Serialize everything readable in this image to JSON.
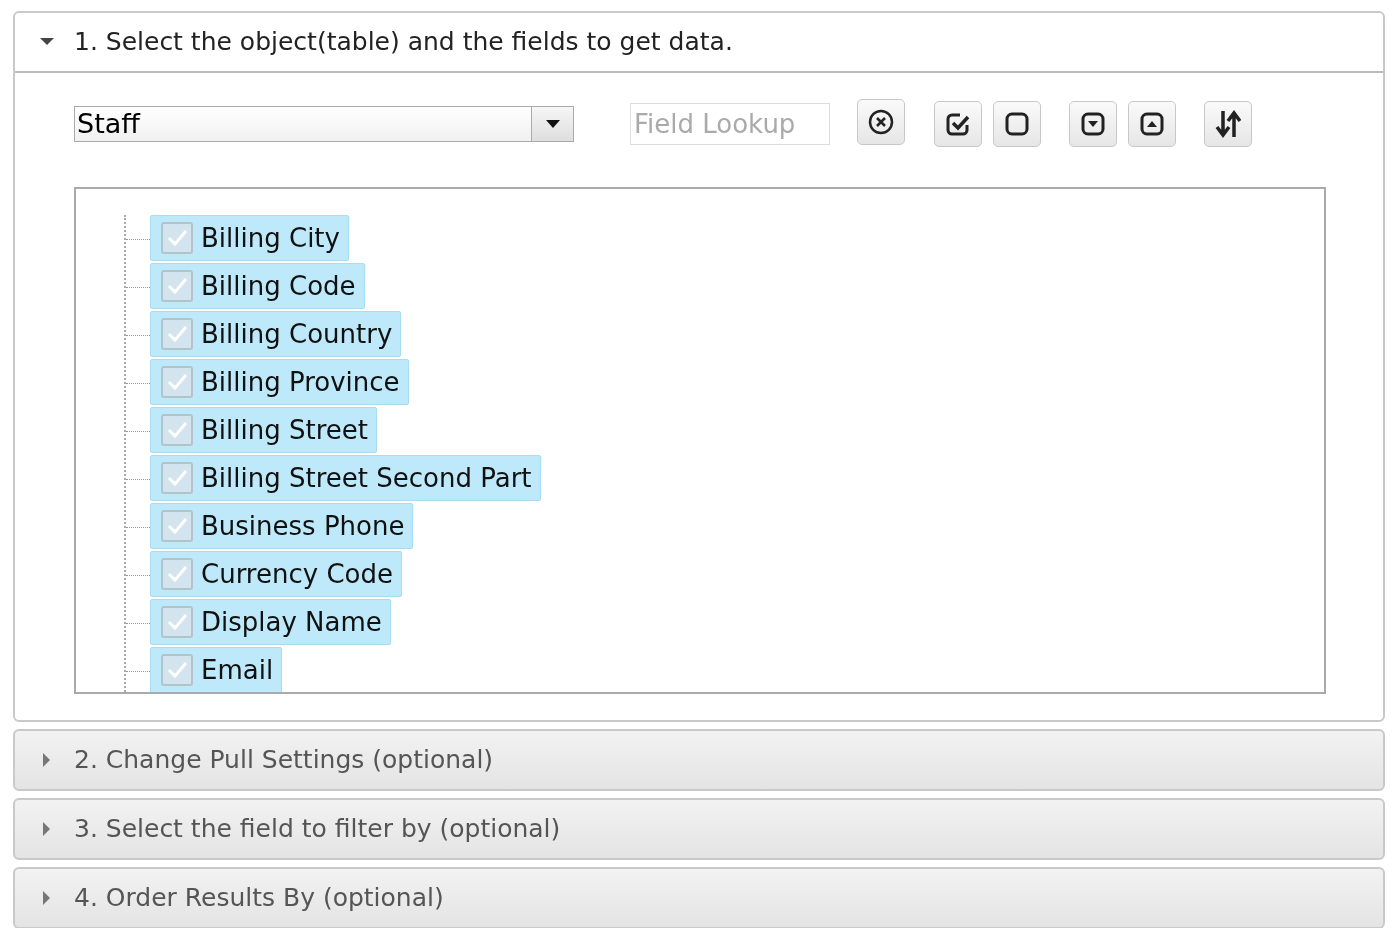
{
  "sections": [
    {
      "title": "1. Select the object(table) and the fields to get data.",
      "expanded": true
    },
    {
      "title": "2. Change Pull Settings (optional)",
      "expanded": false
    },
    {
      "title": "3. Select the field to filter by (optional)",
      "expanded": false
    },
    {
      "title": "4. Order Results By (optional)",
      "expanded": false
    }
  ],
  "object_select": {
    "value": "Staff"
  },
  "field_lookup": {
    "placeholder": "Field Lookup"
  },
  "fields": [
    {
      "label": "Billing City",
      "checked": true,
      "selected": true
    },
    {
      "label": "Billing Code",
      "checked": true,
      "selected": true
    },
    {
      "label": "Billing Country",
      "checked": true,
      "selected": true
    },
    {
      "label": "Billing Province",
      "checked": true,
      "selected": true
    },
    {
      "label": "Billing Street",
      "checked": true,
      "selected": true
    },
    {
      "label": "Billing Street Second Part",
      "checked": true,
      "selected": true
    },
    {
      "label": "Business Phone",
      "checked": true,
      "selected": true
    },
    {
      "label": "Currency Code",
      "checked": true,
      "selected": true
    },
    {
      "label": "Display Name",
      "checked": true,
      "selected": true
    },
    {
      "label": "Email",
      "checked": true,
      "selected": true
    }
  ]
}
